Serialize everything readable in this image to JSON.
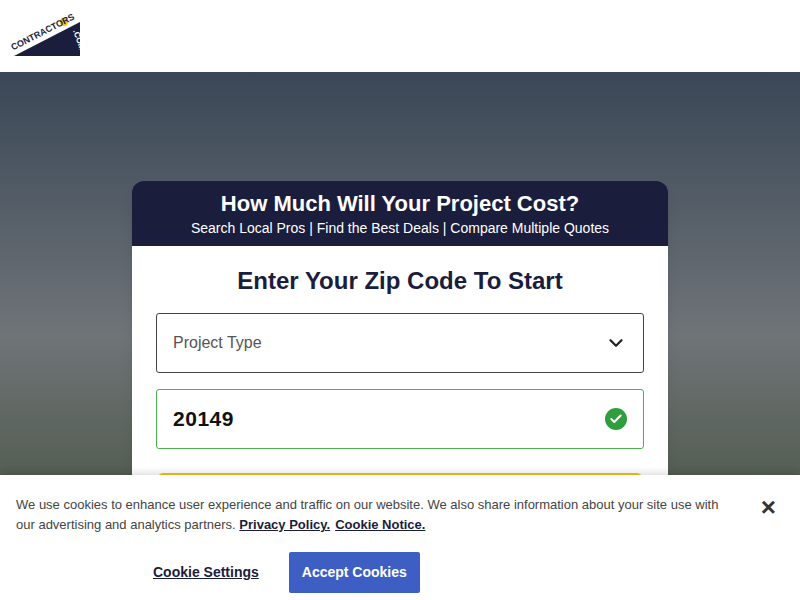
{
  "logo": {
    "name": "CONTRACTORS",
    "suffix": ".COM"
  },
  "card": {
    "title": "How Much Will Your Project Cost?",
    "subtitle": "Search Local Pros | Find the Best Deals | Compare Multiple Quotes",
    "heading": "Enter Your Zip Code To Start",
    "project_select": {
      "placeholder": "Project Type"
    },
    "zip_field": {
      "value": "20149",
      "valid": true
    }
  },
  "cookie_banner": {
    "text": "We use cookies to enhance user experience and traffic on our website. We also share information about your site use with our advertising and analytics partners.",
    "links": [
      "Privacy Policy.",
      "Cookie Notice."
    ],
    "close": "×",
    "settings_button": "Cookie Settings",
    "accept_button": "Accept Cookies"
  }
}
